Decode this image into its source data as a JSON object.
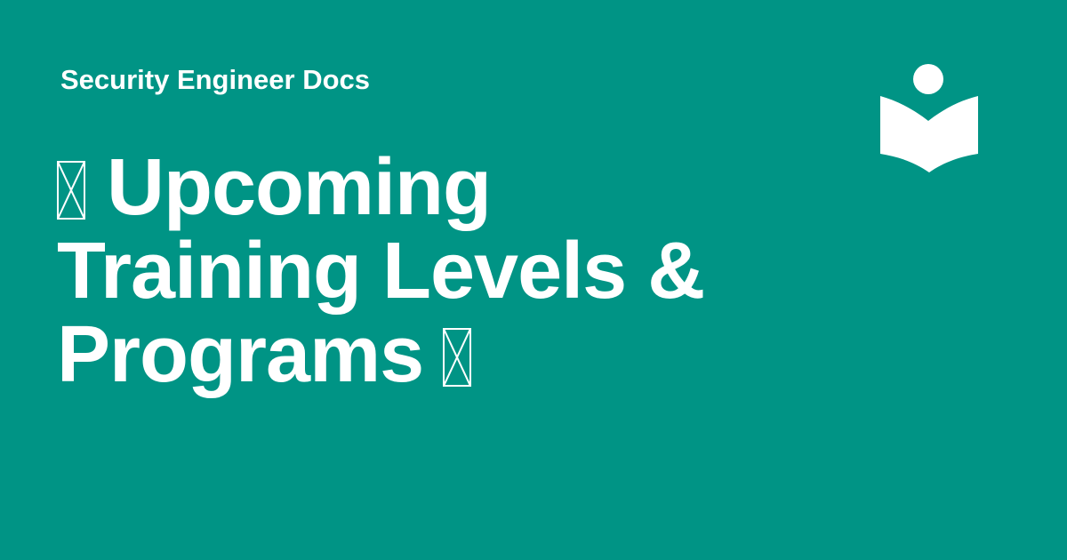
{
  "site": {
    "name": "Security Engineer Docs"
  },
  "page": {
    "title_lines": [
      "Upcoming",
      "Training Levels &",
      "Programs"
    ]
  },
  "logo": {
    "icon": "reader-book-icon"
  },
  "colors": {
    "background": "#009485",
    "foreground": "#ffffff"
  }
}
